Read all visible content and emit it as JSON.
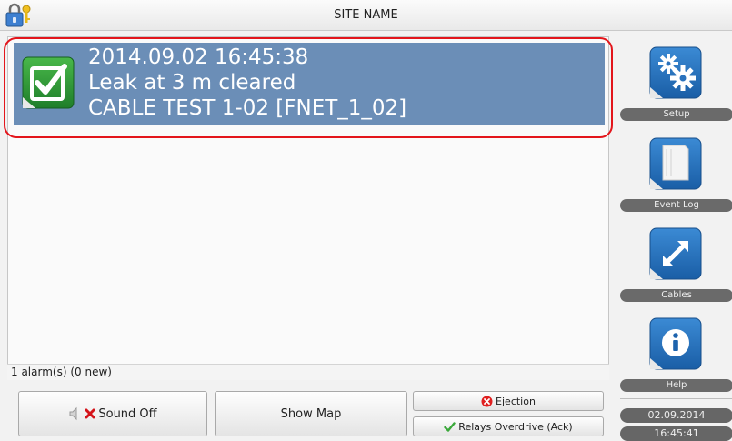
{
  "header": {
    "site_name": "SITE NAME",
    "lock_icon": "lock-key-icon"
  },
  "alarm": {
    "timestamp": "2014.09.02 16:45:38",
    "message": "Leak at 3 m  cleared",
    "source": "CABLE TEST 1-02 [FNET_1_02]",
    "row_color": "#6b8eb7",
    "status_icon": "checkbox-checked-icon"
  },
  "status": {
    "count_text": "1 alarm(s) (0 new)"
  },
  "buttons": {
    "sound_off": "Sound Off",
    "show_map": "Show Map",
    "ejection": "Ejection",
    "relays": "Relays Overdrive (Ack)"
  },
  "sidebar": {
    "setup": "Setup",
    "event_log": "Event Log",
    "cables": "Cables",
    "help": "Help",
    "date": "02.09.2014",
    "time": "16:45:41"
  },
  "colors": {
    "highlight": "#e3151b",
    "sidebar_icon_blue": "#1f6fb8",
    "label_gray": "#6a6a6a"
  }
}
